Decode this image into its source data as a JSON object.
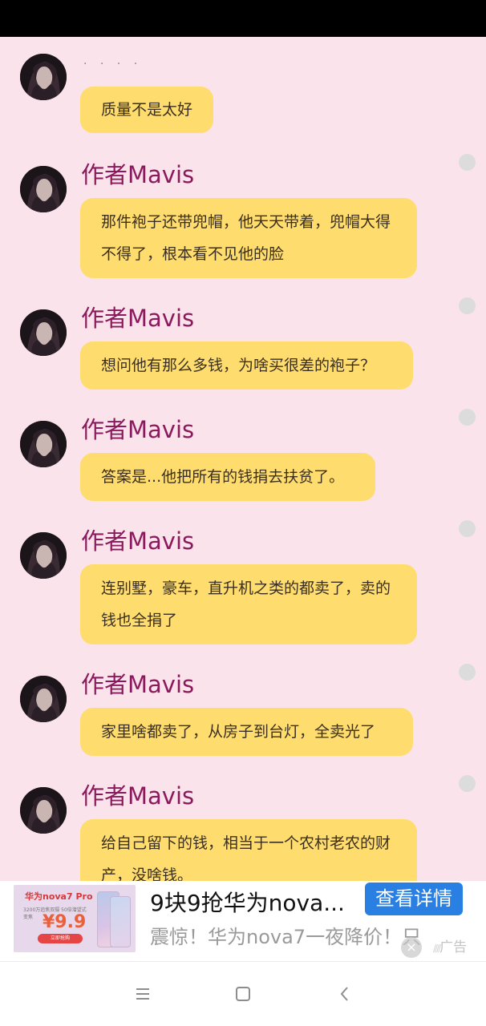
{
  "chat": {
    "top_partial_text": "· · · ·",
    "messages": [
      {
        "author": "",
        "text": "质量不是太好",
        "show_dot": false
      },
      {
        "author": "作者Mavis",
        "text": "那件袍子还带兜帽，他天天带着，兜帽大得不得了，根本看不见他的脸",
        "show_dot": true
      },
      {
        "author": "作者Mavis",
        "text": "想问他有那么多钱，为啥买很差的袍子？",
        "show_dot": true
      },
      {
        "author": "作者Mavis",
        "text": "答案是...他把所有的钱捐去扶贫了。",
        "show_dot": true
      },
      {
        "author": "作者Mavis",
        "text": "连别墅，豪车，直升机之类的都卖了，卖的钱也全捐了",
        "show_dot": true
      },
      {
        "author": "作者Mavis",
        "text": "家里啥都卖了，从房子到台灯，全卖光了",
        "show_dot": true
      },
      {
        "author": "作者Mavis",
        "text": "给自己留下的钱，相当于一个农村老农的财产，没啥钱。",
        "show_dot": true
      }
    ]
  },
  "ad": {
    "image": {
      "brand": "华为nova7 Pro",
      "subtitle": "3200万追焦双摄 50倍潜望式变焦",
      "price": "¥9.9",
      "buy_label": "立即抢购"
    },
    "title": "9块9抢华为nova...",
    "button_label": "查看详情",
    "description": "震惊！华为nova7一夜降价！只",
    "close_icon": "×",
    "label": "广告"
  },
  "navbar": {
    "menu_icon": "≡",
    "home_icon": "□",
    "back_icon": "‹"
  },
  "colors": {
    "background": "#fbe3ec",
    "bubble": "#fedc6e",
    "author": "#8b1a5c",
    "ad_button": "#2a7fe3"
  }
}
